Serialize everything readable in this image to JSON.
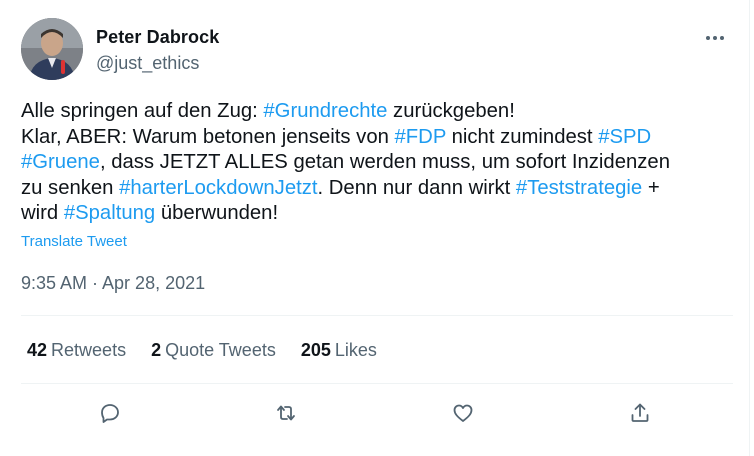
{
  "author": {
    "name": "Peter Dabrock",
    "handle": "@just_ethics"
  },
  "tweet": {
    "segments": [
      {
        "text": "Alle springen auf den Zug: ",
        "tag": false
      },
      {
        "text": "#Grundrechte",
        "tag": true
      },
      {
        "text": " zurückgeben!\nKlar, ABER: Warum betonen jenseits von ",
        "tag": false
      },
      {
        "text": "#FDP",
        "tag": true
      },
      {
        "text": " nicht zumindest ",
        "tag": false
      },
      {
        "text": "#SPD",
        "tag": true
      },
      {
        "text": "\n",
        "tag": false
      },
      {
        "text": "#Gruene",
        "tag": true
      },
      {
        "text": ", dass JETZT ALLES getan werden muss, um sofort Inzidenzen\nzu senken ",
        "tag": false
      },
      {
        "text": "#harterLockdownJetzt",
        "tag": true
      },
      {
        "text": ". Denn nur dann wirkt ",
        "tag": false
      },
      {
        "text": "#Teststrategie",
        "tag": true
      },
      {
        "text": " +\nwird ",
        "tag": false
      },
      {
        "text": "#Spaltung",
        "tag": true
      },
      {
        "text": " überwunden!",
        "tag": false
      }
    ],
    "translate_label": "Translate Tweet",
    "timestamp": "9:35 AM · Apr 28, 2021"
  },
  "stats": {
    "retweets": {
      "count": "42",
      "label": "Retweets"
    },
    "quotes": {
      "count": "2",
      "label": "Quote Tweets"
    },
    "likes": {
      "count": "205",
      "label": "Likes"
    }
  },
  "actions": [
    "reply-icon",
    "retweet-icon",
    "like-icon",
    "share-icon"
  ],
  "colors": {
    "link": "#1d9bf0",
    "muted": "#536471",
    "text": "#0f1419"
  }
}
